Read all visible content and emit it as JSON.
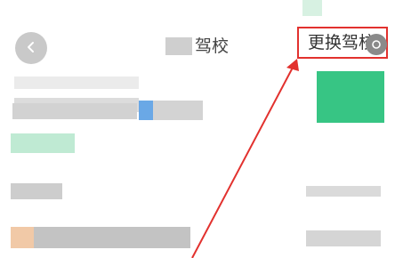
{
  "header": {
    "title": "驾校",
    "change_school_label": "更换驾校",
    "back_icon": "chevron-left-icon",
    "more_icon": "more-icon"
  },
  "annotation": {
    "color": "#e2312e"
  },
  "colors": {
    "accent_green": "#26c07a",
    "highlight_blue": "#6aa8e6"
  }
}
